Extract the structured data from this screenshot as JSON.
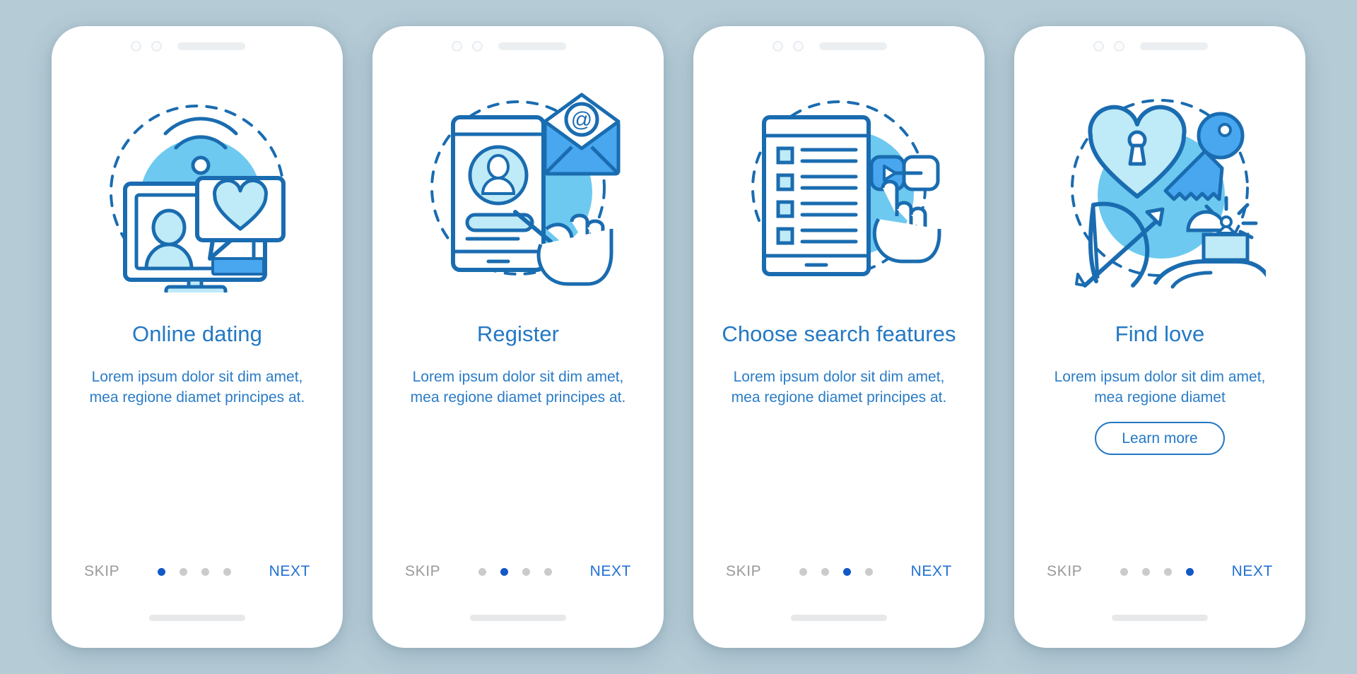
{
  "theme": {
    "background": "#b5cbd6",
    "card_background": "#ffffff",
    "title_color": "#2378c4",
    "desc_color": "#2a7cc7",
    "skip_color": "#9a9a9a",
    "next_color": "#1f6fd0",
    "dot_active": "#1358c7",
    "dot_inactive": "#c9cbcd",
    "stroke_dark": "#1a6cb0",
    "fill_light": "#bfeaf7",
    "fill_mid": "#6dc9ef",
    "fill_accent": "#48a7ef"
  },
  "screens": [
    {
      "id": "online-dating",
      "illustration": "video-chat-heart-icon",
      "title": "Online dating",
      "description": "Lorem ipsum dolor sit dim amet, mea regione diamet principes at.",
      "has_learn_more": false,
      "learn_more_label": "",
      "skip_label": "SKIP",
      "next_label": "NEXT",
      "dot_count": 4,
      "active_dot": 0
    },
    {
      "id": "register",
      "illustration": "phone-profile-envelope-icon",
      "title": "Register",
      "description": "Lorem ipsum dolor sit dim amet, mea regione diamet principes at.",
      "has_learn_more": false,
      "learn_more_label": "",
      "skip_label": "SKIP",
      "next_label": "NEXT",
      "dot_count": 4,
      "active_dot": 1
    },
    {
      "id": "choose-search-features",
      "illustration": "tablet-checklist-toggle-icon",
      "title": "Choose search features",
      "description": "Lorem ipsum dolor sit dim amet, mea regione diamet principes at.",
      "has_learn_more": false,
      "learn_more_label": "",
      "skip_label": "SKIP",
      "next_label": "NEXT",
      "dot_count": 4,
      "active_dot": 2
    },
    {
      "id": "find-love",
      "illustration": "heart-lock-key-bow-ring-icon",
      "title": "Find love",
      "description": "Lorem ipsum dolor sit dim amet, mea regione diamet",
      "has_learn_more": true,
      "learn_more_label": "Learn more",
      "skip_label": "SKIP",
      "next_label": "NEXT",
      "dot_count": 4,
      "active_dot": 3
    }
  ]
}
